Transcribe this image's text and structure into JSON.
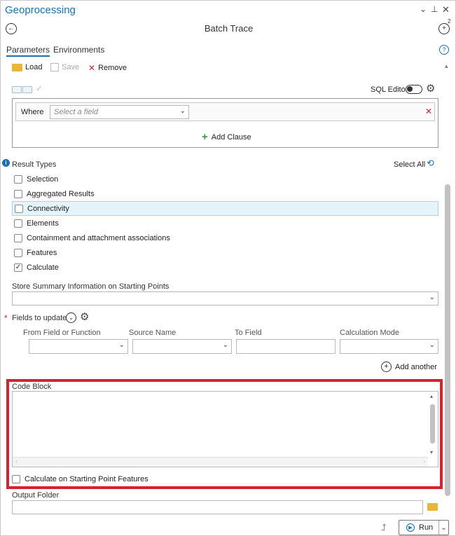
{
  "header": {
    "title": "Geoprocessing",
    "tool_name": "Batch Trace"
  },
  "tabs": [
    {
      "label": "Parameters",
      "active": true
    },
    {
      "label": "Environments",
      "active": false
    }
  ],
  "query_toolbar": {
    "load": "Load",
    "save": "Save",
    "remove": "Remove",
    "sql_editor": "SQL Editor"
  },
  "query": {
    "where_label": "Where",
    "field_placeholder": "Select a field",
    "add_clause": "Add Clause"
  },
  "result_types": {
    "label": "Result Types",
    "select_all": "Select All",
    "items": [
      {
        "label": "Selection",
        "checked": false
      },
      {
        "label": "Aggregated Results",
        "checked": false
      },
      {
        "label": "Connectivity",
        "checked": false,
        "highlighted": true
      },
      {
        "label": "Elements",
        "checked": false
      },
      {
        "label": "Containment and attachment associations",
        "checked": false
      },
      {
        "label": "Features",
        "checked": false
      },
      {
        "label": "Calculate",
        "checked": true
      }
    ]
  },
  "store_summary": {
    "label": "Store Summary Information on Starting Points",
    "value": ""
  },
  "fields_to_update": {
    "label": "Fields to update",
    "columns": [
      "From Field or Function",
      "Source Name",
      "To Field",
      "Calculation Mode"
    ],
    "add_another": "Add another"
  },
  "code_block": {
    "label": "Code Block",
    "value": "",
    "calc_on_start": "Calculate on Starting Point Features",
    "calc_on_start_checked": false
  },
  "output_folder": {
    "label": "Output Folder",
    "value": ""
  },
  "footer": {
    "run": "Run"
  }
}
